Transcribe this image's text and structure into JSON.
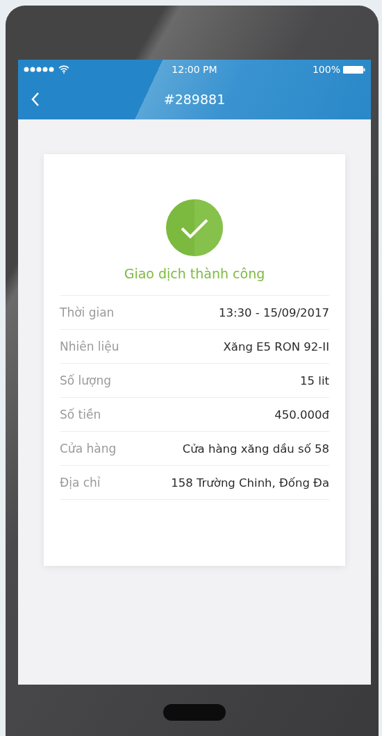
{
  "status_bar": {
    "time": "12:00 PM",
    "battery": "100%"
  },
  "nav_bar": {
    "title": "#289881"
  },
  "receipt": {
    "status_text": "Giao dịch thành công",
    "rows": [
      {
        "label": "Thời gian",
        "value": "13:30 - 15/09/2017"
      },
      {
        "label": "Nhiên liệu",
        "value": "Xăng E5 RON 92-II"
      },
      {
        "label": "Số lượng",
        "value": "15 lit"
      },
      {
        "label": "Số tiền",
        "value": "450.000đ"
      },
      {
        "label": "Cửa hàng",
        "value": "Cửa hàng xăng dầu số 58"
      },
      {
        "label": "Địa chỉ",
        "value": "158 Trường Chinh, Đống Đa"
      }
    ]
  }
}
